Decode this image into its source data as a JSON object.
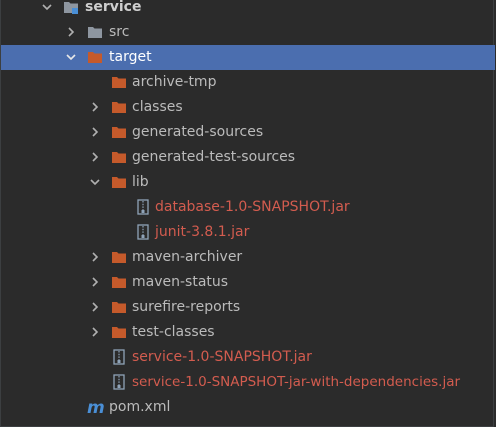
{
  "tree": {
    "items": [
      {
        "label": "service",
        "icon": "module-folder-icon",
        "expanded": true
      },
      {
        "label": "src",
        "icon": "folder-icon",
        "expanded": false
      },
      {
        "label": "target",
        "icon": "excluded-folder-icon",
        "expanded": true,
        "selected": true
      },
      {
        "label": "archive-tmp",
        "icon": "excluded-folder-icon"
      },
      {
        "label": "classes",
        "icon": "excluded-folder-icon",
        "expanded": false
      },
      {
        "label": "generated-sources",
        "icon": "excluded-folder-icon",
        "expanded": false
      },
      {
        "label": "generated-test-sources",
        "icon": "excluded-folder-icon",
        "expanded": false
      },
      {
        "label": "lib",
        "icon": "excluded-folder-icon",
        "expanded": true
      },
      {
        "label": "database-1.0-SNAPSHOT.jar",
        "icon": "jar-icon"
      },
      {
        "label": "junit-3.8.1.jar",
        "icon": "jar-icon"
      },
      {
        "label": "maven-archiver",
        "icon": "excluded-folder-icon",
        "expanded": false
      },
      {
        "label": "maven-status",
        "icon": "excluded-folder-icon",
        "expanded": false
      },
      {
        "label": "surefire-reports",
        "icon": "excluded-folder-icon",
        "expanded": false
      },
      {
        "label": "test-classes",
        "icon": "excluded-folder-icon",
        "expanded": false
      },
      {
        "label": "service-1.0-SNAPSHOT.jar",
        "icon": "jar-icon"
      },
      {
        "label": "service-1.0-SNAPSHOT-jar-with-dependencies.jar",
        "icon": "jar-icon"
      },
      {
        "label": "pom.xml",
        "icon": "maven-icon"
      }
    ]
  },
  "colors": {
    "background": "#2b2b2b",
    "selection": "#4b6eaf",
    "text": "#bbbbbb",
    "excluded_text": "#d35c4f",
    "excluded_folder": "#c55a2b",
    "folder": "#8e96a0",
    "maven": "#4a8fd6"
  }
}
